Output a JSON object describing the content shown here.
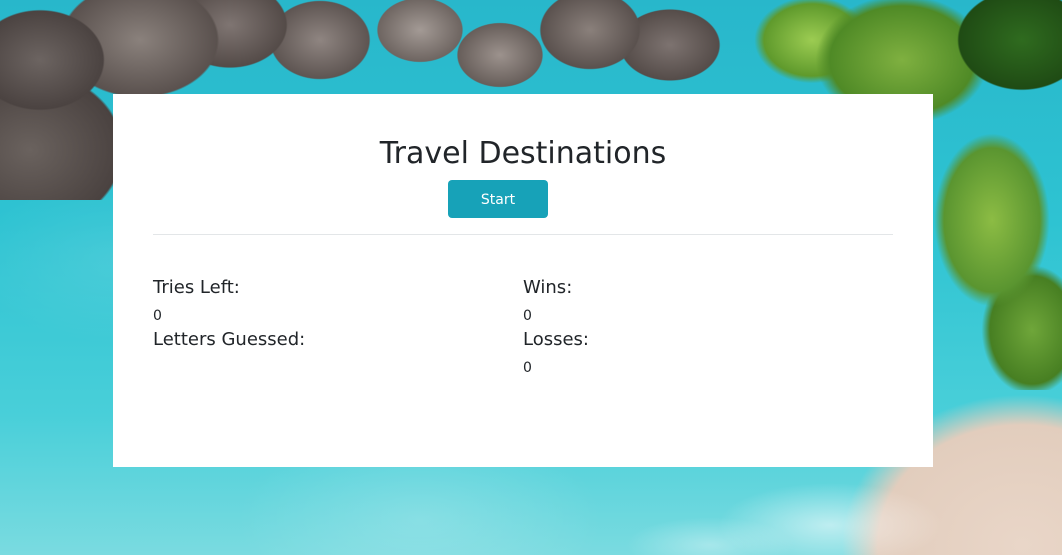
{
  "game": {
    "title": "Travel Destinations",
    "start_label": "Start"
  },
  "stats": {
    "tries_left_label": "Tries Left:",
    "tries_left_value": "0",
    "letters_guessed_label": "Letters Guessed:",
    "letters_guessed_value": "",
    "wins_label": "Wins:",
    "wins_value": "0",
    "losses_label": "Losses:",
    "losses_value": "0"
  },
  "colors": {
    "accent": "#17a2b8",
    "card": "#ffffff",
    "text": "#212529"
  }
}
